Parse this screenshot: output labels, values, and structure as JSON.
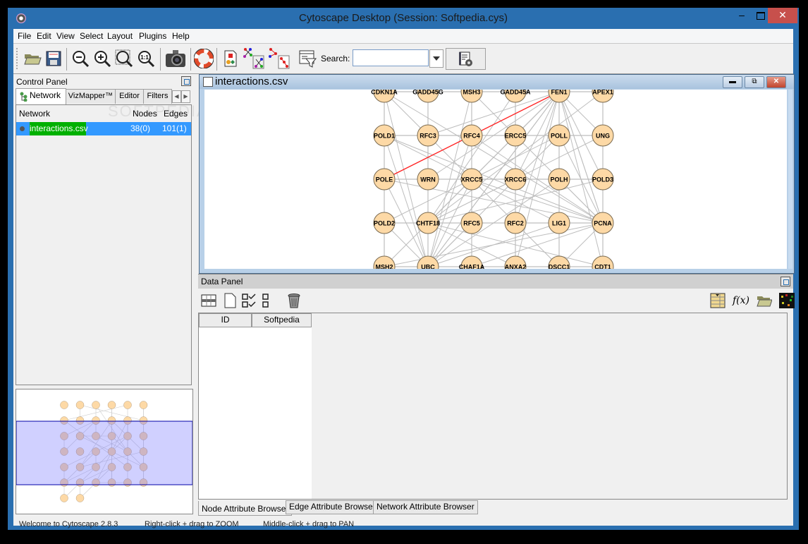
{
  "window": {
    "title": "Cytoscape Desktop (Session: Softpedia.cys)",
    "controls": {
      "minimize": "–",
      "close": "✕"
    }
  },
  "menubar": [
    "File",
    "Edit",
    "View",
    "Select",
    "Layout",
    "Plugins",
    "Help"
  ],
  "toolbar": {
    "buttons": [
      {
        "name": "open-session",
        "icon": "folder-open-icon"
      },
      {
        "name": "save-session",
        "icon": "floppy-disk-icon"
      },
      {
        "name": "zoom-out",
        "icon": "zoom-out-icon"
      },
      {
        "name": "zoom-in",
        "icon": "zoom-in-icon"
      },
      {
        "name": "zoom-selected",
        "icon": "zoom-selected-icon"
      },
      {
        "name": "zoom-fit",
        "icon": "zoom-fit-icon",
        "glyph": "1:1"
      },
      {
        "name": "export-image",
        "icon": "camera-icon"
      },
      {
        "name": "help",
        "icon": "lifebuoy-icon"
      },
      {
        "name": "vizmapper",
        "icon": "vizmapper-icon"
      },
      {
        "name": "create-subnetwork-all-edges",
        "icon": "subnetwork-all-icon"
      },
      {
        "name": "create-subnetwork-selected-edges",
        "icon": "subnetwork-selected-icon"
      },
      {
        "name": "filter",
        "icon": "filter-icon"
      }
    ],
    "search_label": "Search:",
    "search_value": "",
    "search_options_icon": "search-options-icon"
  },
  "control_panel": {
    "title": "Control Panel",
    "tabs": [
      "Network",
      "VizMapper™",
      "Editor",
      "Filters"
    ],
    "active_tab": "Network",
    "table_headers": {
      "network": "Network",
      "nodes": "Nodes",
      "edges": "Edges"
    },
    "networks": [
      {
        "name": "interactions.csv",
        "nodes": "38(0)",
        "edges": "101(1)",
        "selected": true
      }
    ],
    "watermark": "SOFTPEDIA"
  },
  "network_view": {
    "title": "interactions.csv",
    "colors": {
      "node_fill": "#fdd9a6",
      "node_border": "#7a6a50",
      "edge": "#bdbdbd",
      "selected_edge": "#ff2020"
    },
    "rows": [
      [
        "CDKN1A",
        "GADD45G",
        "MSH3",
        "GADD45A",
        "FEN1",
        "APEX1"
      ],
      [
        "POLD1",
        "RFC3",
        "RFC4",
        "ERCC5",
        "POLL",
        "UNG"
      ],
      [
        "POLE",
        "WRN",
        "XRCC5",
        "XRCC6",
        "POLH",
        "POLD3"
      ],
      [
        "POLD2",
        "CHTF18",
        "RFC5",
        "RFC2",
        "LIG1",
        "PCNA"
      ],
      [
        "MSH2",
        "UBC",
        "CHAF1A",
        "ANXA2",
        "DSCC1",
        "CDT1"
      ]
    ],
    "selected_edge": [
      "POLE",
      "FEN1"
    ]
  },
  "data_panel": {
    "title": "Data Panel",
    "tools_left": [
      "select-attributes-icon",
      "new-attribute-icon",
      "select-all-icon",
      "deselect-all-icon",
      "delete-attribute-icon"
    ],
    "tools_right": [
      "import-table-icon",
      "function-icon",
      "open-folder-icon",
      "heatmap-icon"
    ],
    "function_glyph": "f(x)",
    "columns": [
      "ID",
      "Softpedia"
    ],
    "tabs": [
      "Node Attribute Browser",
      "Edge Attribute Browser",
      "Network Attribute Browser"
    ],
    "active_tab": "Node Attribute Browser"
  },
  "statusbar": [
    "Welcome to Cytoscape 2.8.3",
    "Right-click + drag to ZOOM",
    "Middle-click + drag to PAN"
  ]
}
